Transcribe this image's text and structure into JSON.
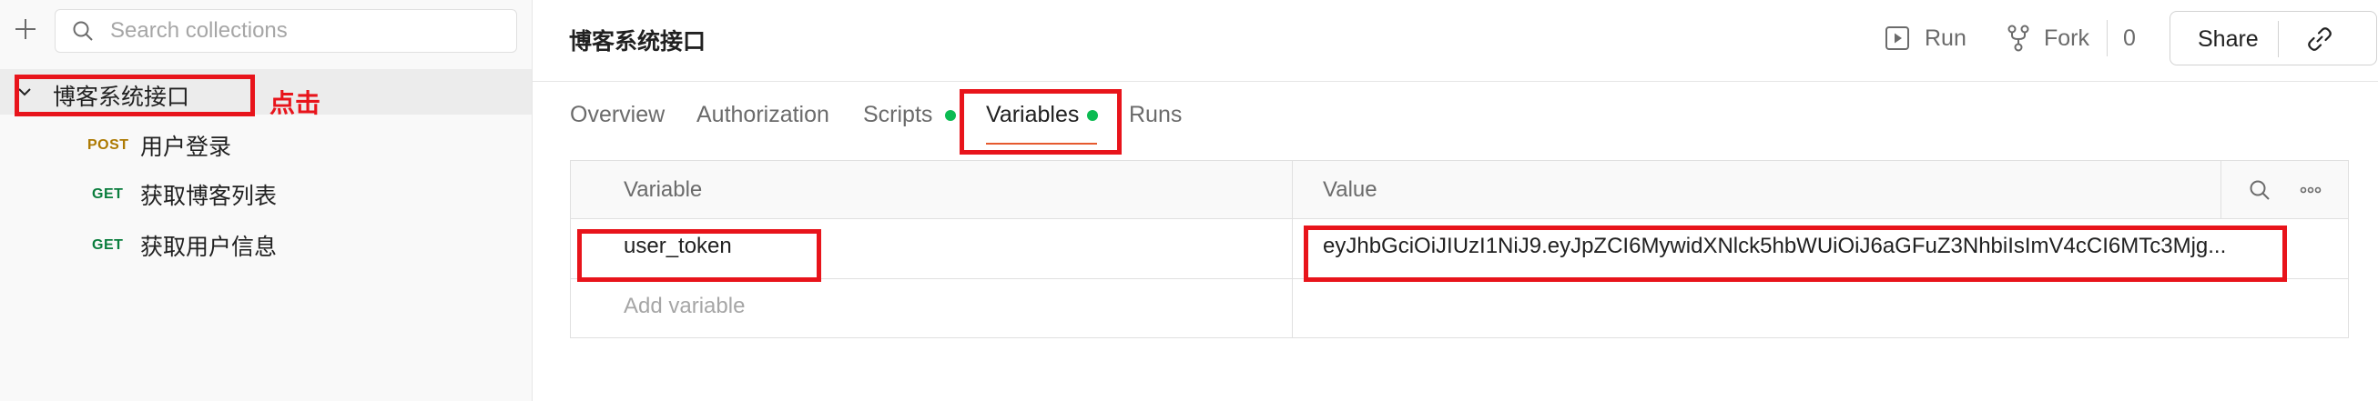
{
  "sidebar": {
    "search_placeholder": "Search collections",
    "collection": {
      "name": "博客系统接口",
      "expanded": true
    },
    "requests": [
      {
        "method": "POST",
        "name": "用户登录"
      },
      {
        "method": "GET",
        "name": "获取博客列表"
      },
      {
        "method": "GET",
        "name": "获取用户信息"
      }
    ],
    "annotation_label": "点击"
  },
  "header": {
    "title": "博客系统接口",
    "run_label": "Run",
    "fork_label": "Fork",
    "fork_count": "0",
    "share_label": "Share"
  },
  "tabs": [
    {
      "label": "Overview",
      "active": false
    },
    {
      "label": "Authorization",
      "active": false
    },
    {
      "label": "Scripts",
      "active": false,
      "status_dot": true
    },
    {
      "label": "Variables",
      "active": true,
      "status_dot": true
    },
    {
      "label": "Runs",
      "active": false
    }
  ],
  "variables_table": {
    "headers": {
      "variable": "Variable",
      "value": "Value"
    },
    "rows": [
      {
        "variable": "user_token",
        "value": "eyJhbGciOiJIUzI1NiJ9.eyJpZCI6MywidXNlck5hbWUiOiJ6aGFuZ3NhbiIsImV4cCI6MTc3Mjg..."
      }
    ],
    "add_placeholder": "Add variable"
  },
  "colors": {
    "annotation": "#e8141b",
    "tab_active_underline": "#e65a2f",
    "status_dot": "#0cbb52",
    "post_method": "#ad7a03",
    "get_method": "#0a7d3d"
  },
  "icons": [
    "plus-icon",
    "search-icon",
    "chevron-down-icon",
    "play-icon",
    "fork-icon",
    "link-icon",
    "more-icon"
  ]
}
